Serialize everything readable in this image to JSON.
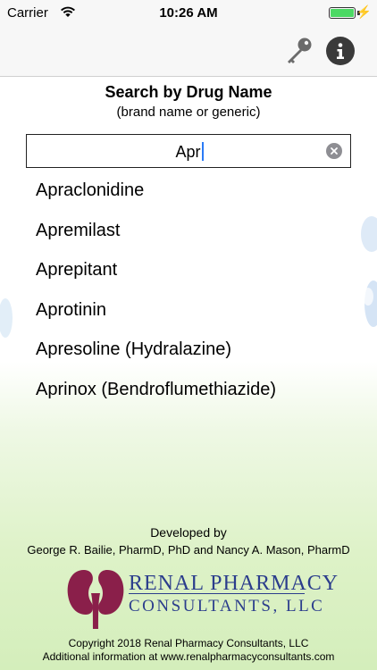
{
  "status_bar": {
    "carrier": "Carrier",
    "time": "10:26 AM"
  },
  "nav": {
    "key_icon": "key-icon",
    "info_icon": "info-icon"
  },
  "search": {
    "title": "Search by Drug Name",
    "subtitle": "(brand name or generic)",
    "value": "Apr"
  },
  "results": [
    "Apraclonidine",
    "Apremilast",
    "Aprepitant",
    "Aprotinin",
    "Apresoline (Hydralazine)",
    "Aprinox (Bendroflumethiazide)"
  ],
  "footer": {
    "developed_by": "Developed by",
    "authors": "George R. Bailie, PharmD, PhD and Nancy A. Mason, PharmD",
    "logo_line1": "RENAL PHARMACY",
    "logo_line2": "CONSULTANTS, LLC",
    "copyright": "Copyright 2018 Renal Pharmacy Consultants, LLC",
    "more_info": "Additional information at www.renalpharmacyconsultants.com"
  },
  "colors": {
    "battery": "#4cd964",
    "caret": "#2a7bf6",
    "logo_blue": "#2b3d8c",
    "logo_maroon": "#8a1f4a",
    "gradient_green": "#d4eebb"
  }
}
